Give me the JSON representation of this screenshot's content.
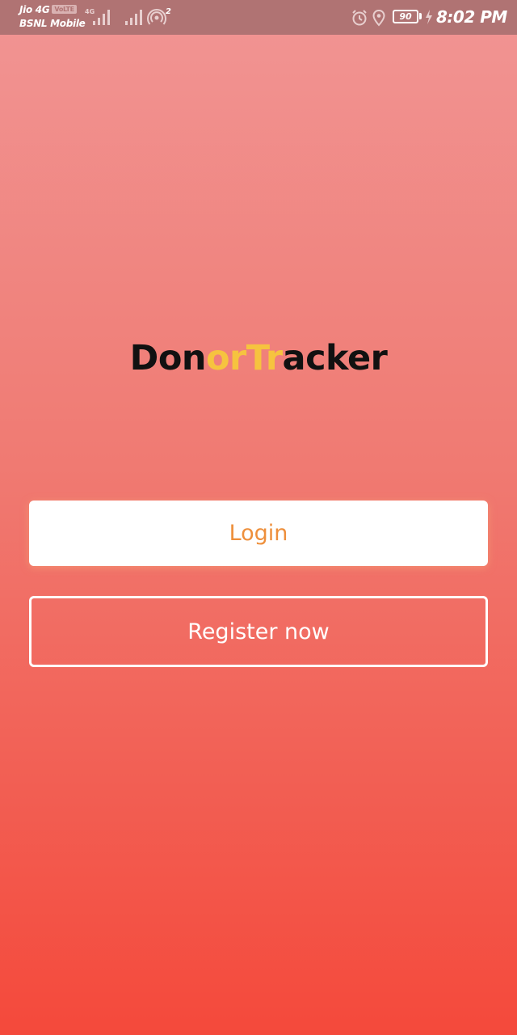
{
  "status_bar": {
    "carrier_1": "Jio 4G",
    "volte_badge": "VoLTE",
    "carrier_2": "BSNL Mobile",
    "network_type": "4G",
    "hotspot_count": "2",
    "battery_level": "90",
    "time": "8:02 PM"
  },
  "logo": {
    "part_1": "Don",
    "part_2": "orTr",
    "part_3": "acker",
    "color_dark": "#111111",
    "color_accent": "#f6c33f"
  },
  "actions": {
    "login_label": "Login",
    "register_label": "Register now"
  },
  "colors": {
    "background_top": "#f19594",
    "background_bottom": "#f4493b",
    "login_text": "#ee8f3b"
  }
}
